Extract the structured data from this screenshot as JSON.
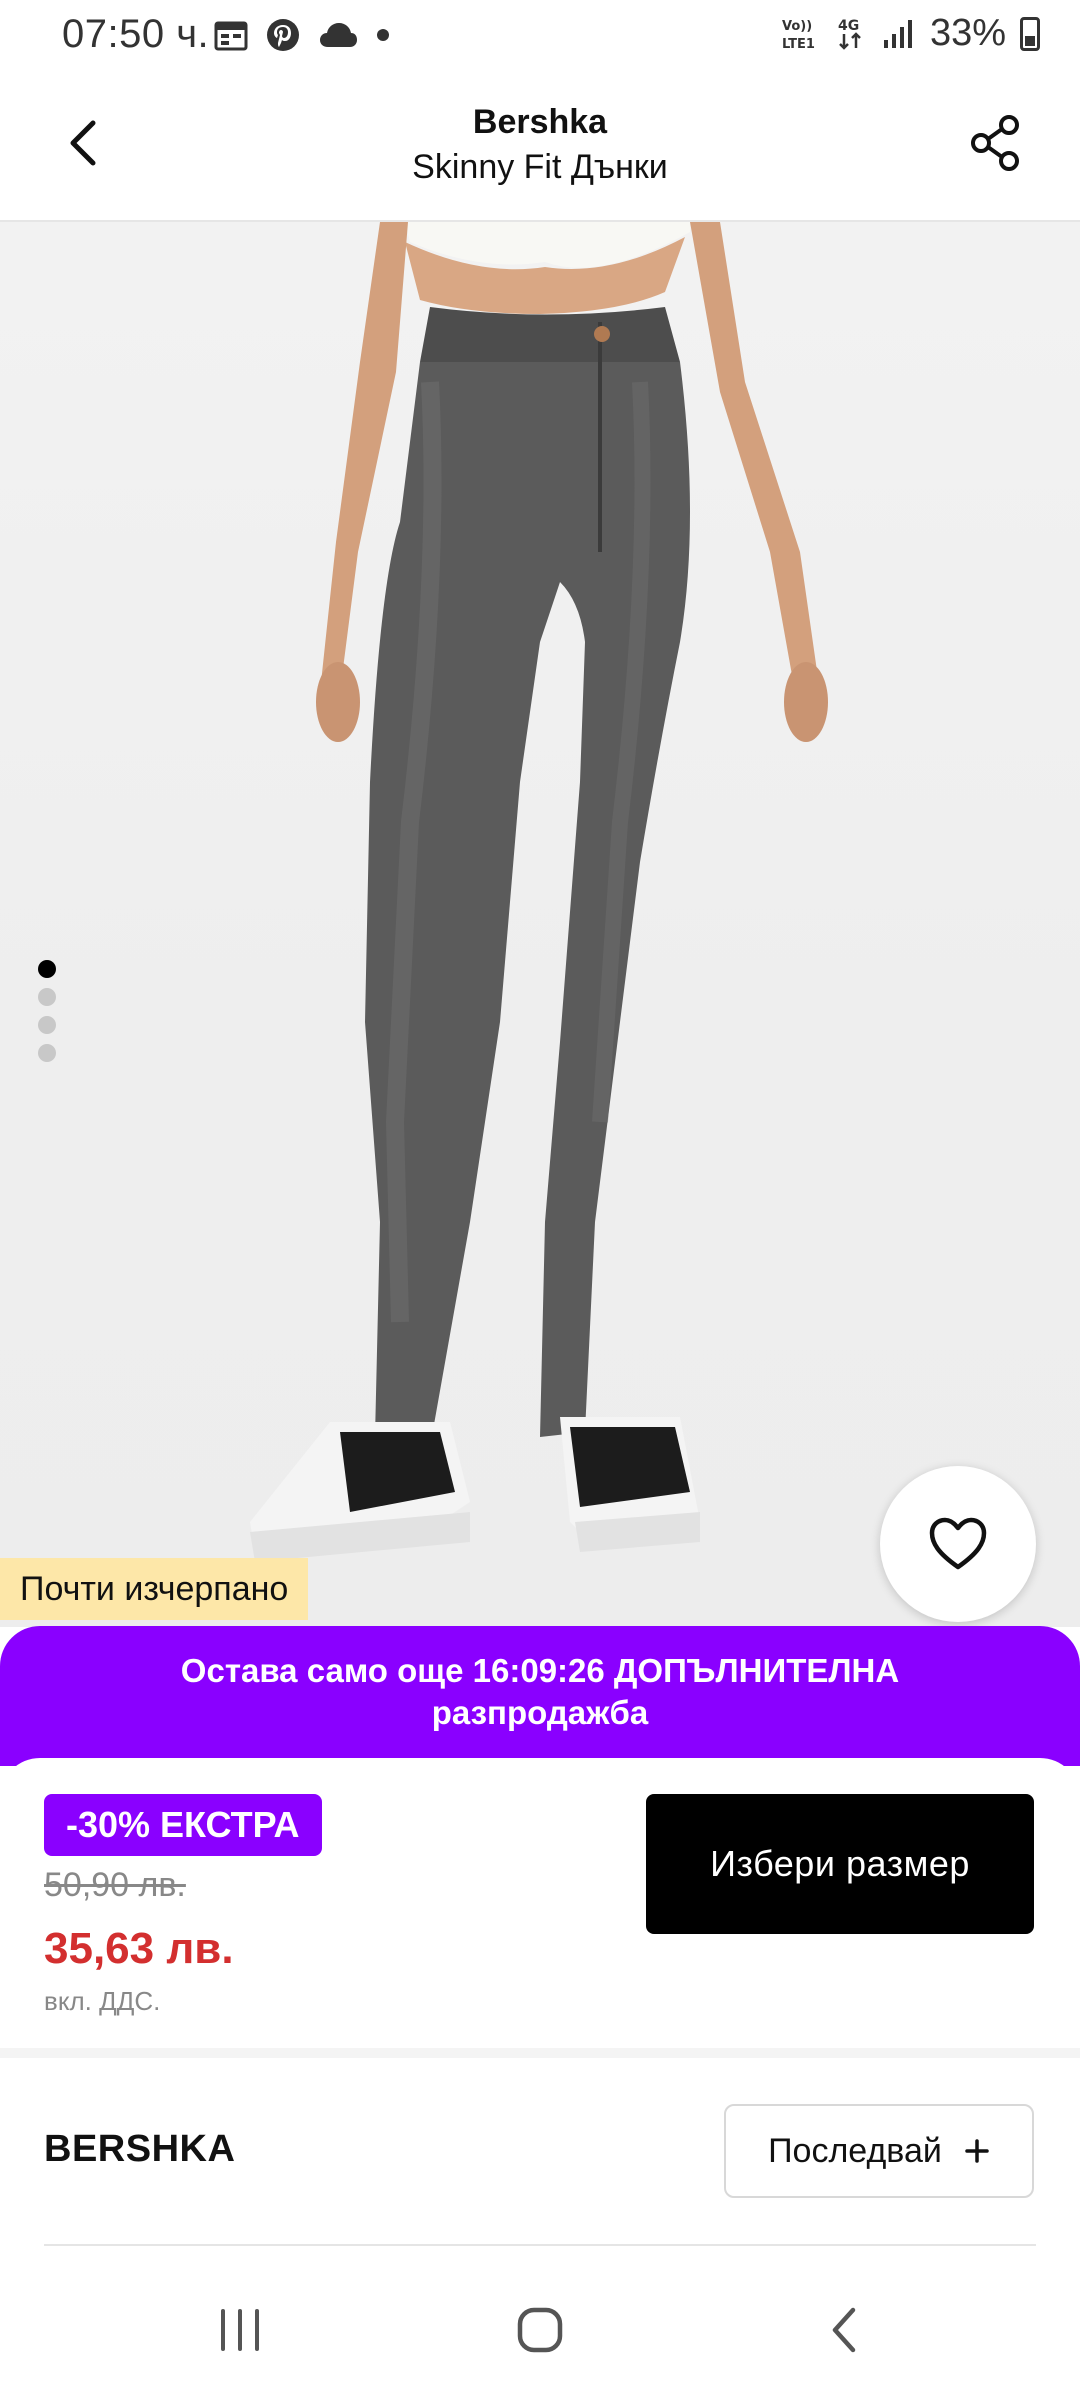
{
  "status_bar": {
    "time": "07:50 ч.",
    "network": "4G",
    "volte": "Vo)) LTE1",
    "battery": "33%",
    "icons": [
      "calendar-icon",
      "pinterest-icon",
      "cloud-icon",
      "dot-icon"
    ]
  },
  "header": {
    "brand": "Bershka",
    "title": "Skinny Fit Дънки",
    "back_icon": "back-arrow-icon",
    "share_icon": "share-icon"
  },
  "gallery": {
    "image_count": 4,
    "active_index": 0,
    "stock_label": "Почти изчерпано",
    "wishlist_icon": "heart-icon"
  },
  "promo": {
    "text": "Остава само още 16:09:26 ДОПЪЛНИТЕЛНА разпродажба",
    "color": "#8a00ff"
  },
  "pricing": {
    "discount_badge": "-30% ЕКСТРА",
    "old_price": "50,90 лв.",
    "new_price": "35,63 лв.",
    "vat_note": "вкл. ДДС.",
    "price_color": "#d32f2f"
  },
  "actions": {
    "select_size_label": "Избери размер"
  },
  "brand_section": {
    "name": "BERSHKA",
    "follow_label": "Последвай"
  },
  "nav_bar": {
    "recent_icon": "recent-apps-icon",
    "home_icon": "home-icon",
    "back_icon": "nav-back-icon"
  }
}
